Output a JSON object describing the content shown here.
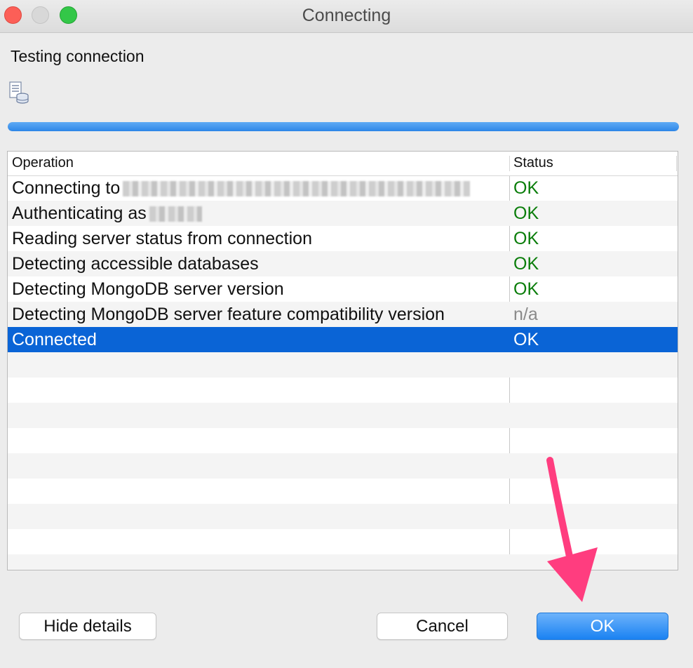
{
  "window": {
    "title": "Connecting"
  },
  "heading": "Testing connection",
  "progress": {
    "fraction": 1.0
  },
  "table": {
    "columns": [
      "Operation",
      "Status"
    ],
    "rows": [
      {
        "operation": "Connecting to",
        "status": "OK",
        "status_color": "#0a7d0a",
        "redacted": true
      },
      {
        "operation": "Authenticating as",
        "status": "OK",
        "status_color": "#0a7d0a",
        "redacted": true
      },
      {
        "operation": "Reading server status from connection",
        "status": "OK",
        "status_color": "#0a7d0a"
      },
      {
        "operation": "Detecting accessible databases",
        "status": "OK",
        "status_color": "#0a7d0a"
      },
      {
        "operation": "Detecting MongoDB server version",
        "status": "OK",
        "status_color": "#0a7d0a"
      },
      {
        "operation": "Detecting MongoDB server feature compatibility version",
        "status": "n/a",
        "status_color": "#8a8a8a"
      },
      {
        "operation": "Connected",
        "status": "OK",
        "status_color": "#ffffff",
        "selected": true
      }
    ],
    "empty_rows": 9
  },
  "buttons": {
    "hide_details": "Hide details",
    "cancel": "Cancel",
    "ok": "OK"
  },
  "colors": {
    "selection": "#0a64d6",
    "accent_arrow": "#ff3d7f"
  },
  "icons": [
    "close-icon",
    "minimize-icon",
    "zoom-icon",
    "database-icon",
    "arrow-annotation-icon"
  ]
}
